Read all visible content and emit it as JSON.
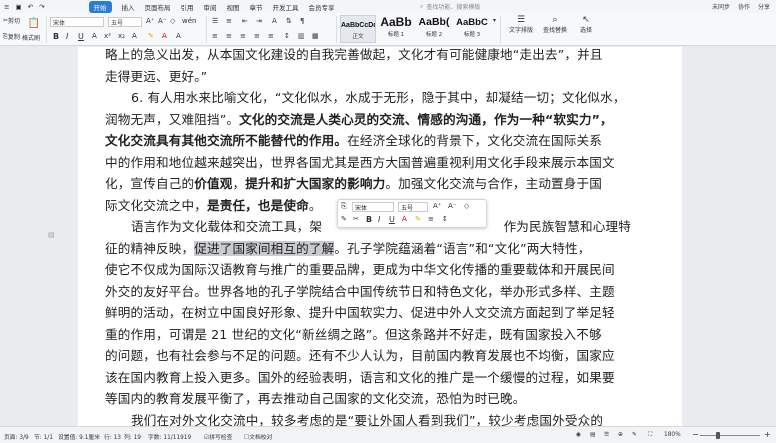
{
  "menu": {
    "left_icons": [
      "menu-icon",
      "save-icon",
      "undo-icon",
      "redo-icon"
    ],
    "tabs": [
      {
        "label": "开始",
        "active": true
      },
      {
        "label": "插入"
      },
      {
        "label": "页面布局"
      },
      {
        "label": "引用"
      },
      {
        "label": "审阅"
      },
      {
        "label": "视图"
      },
      {
        "label": "章节"
      },
      {
        "label": "开发工具"
      },
      {
        "label": "会员专享"
      }
    ],
    "search_placeholder": "查找功能、搜索模板",
    "right_items": [
      "未同步",
      "协作",
      "分享"
    ]
  },
  "ribbon": {
    "cut": "剪切",
    "copy": "复制",
    "paste": "粘贴",
    "format_painter": "格式刷",
    "font_name": "宋体",
    "font_size": "五号",
    "bold": "B",
    "italic": "I",
    "underline": "U",
    "styles": [
      {
        "sample": "AaBbCcDd",
        "label": "正文"
      },
      {
        "sample": "AaBb",
        "label": "标题 1"
      },
      {
        "sample": "AaBb(",
        "label": "标题 2"
      },
      {
        "sample": "AaBbC",
        "label": "标题 3"
      }
    ],
    "text_layout": "文字排版",
    "find_replace": "查找替换",
    "select": "选择"
  },
  "document": {
    "paragraphs": [
      {
        "text": "略上的急义出发，从本国文化建设的自我完善做起，文化才有可能健康地“走出去”，并且"
      },
      {
        "text": "走得更远、更好。”"
      },
      {
        "parts": [
          {
            "t": "6. 有人用水来比喻文化，“文化似水，水成于无形，隐于其中，却凝结一切；文化似水，"
          }
        ]
      },
      {
        "parts": [
          {
            "t": "润物无声，又难阻挡”。"
          },
          {
            "t": "文化的交流是人类心灵的交流、情感的沟通，作为一种“软实力”，",
            "b": true
          }
        ]
      },
      {
        "parts": [
          {
            "t": "文化交流具有其他交流所不能替代的作用。",
            "b": true
          },
          {
            "t": "在经济全球化的背景下，文化交流在国际关系"
          }
        ]
      },
      {
        "text": "中的作用和地位越来越突出，世界各国尤其是西方大国普遍重视利用文化手段来展示本国文"
      },
      {
        "parts": [
          {
            "t": "化，宣传自己的"
          },
          {
            "t": "价值观",
            "b": true
          },
          {
            "t": "，"
          },
          {
            "t": "提升和扩大国家的影响力",
            "b": true
          },
          {
            "t": "。加强文化交流与合作，主动置身于国"
          }
        ]
      },
      {
        "parts": [
          {
            "t": "际文化交流之中，"
          },
          {
            "t": "是责任，也是使命",
            "b": true
          },
          {
            "t": "。"
          }
        ]
      },
      {
        "parts": [
          {
            "t": "语言作为文化载体和交流工具，架"
          },
          {
            "t": "作为民族智慧和心理特",
            "right": true
          }
        ]
      },
      {
        "parts": [
          {
            "t": "征的精神反映，"
          },
          {
            "t": "促进了国家间相互的了解",
            "sel": true
          },
          {
            "t": "。孔子学院蕴涵着“语言”和“文化”两大特性，"
          }
        ]
      },
      {
        "text": "使它不仅成为国际汉语教育与推广的重要品牌，更成为中华文化传播的重要载体和开展民间"
      },
      {
        "text": "外交的友好平台。世界各地的孔子学院结合中国传统节日和特色文化，举办形式多样、主题"
      },
      {
        "text": "鲜明的活动，在树立中国良好形象、提升中国软实力、促进中外人文交流方面起到了举足轻"
      },
      {
        "text": "重的作用，可谓是 21 世纪的文化“新丝绸之路”。但这条路并不好走，既有国家投入不够"
      },
      {
        "text": "的问题，也有社会参与不足的问题。还有不少人认为，目前国内教育发展也不均衡，国家应"
      },
      {
        "text": "该在国内教育上投入更多。国外的经验表明，语言和文化的推广是一个缓慢的过程，如果要"
      },
      {
        "text": "等国内的教育发展平衡了，再去推动自己国家的文化交流，恐怕为时已晚。"
      },
      {
        "text": "我们在对外文化交流中，较多考虑的是“要让外国人看到我们”，较少考虑国外受众的"
      }
    ]
  },
  "mini_toolbar": {
    "font_name": "宋体",
    "font_size": "五号",
    "bold": "B",
    "italic": "I",
    "underline": "U",
    "icons": [
      "copy-icon",
      "format-painter-icon",
      "grow-font-icon",
      "shrink-font-icon",
      "clear-format-icon",
      "font-color-icon",
      "highlight-icon",
      "align-icon",
      "line-spacing-icon"
    ]
  },
  "status": {
    "page": "页面: 3/9",
    "section": "节: 1/1",
    "setting": "设置值: 9.1厘米",
    "row": "行: 13",
    "col": "列: 19",
    "wordcount": "字数: 11/11919",
    "spellcheck": "拼写检查",
    "proofread": "文档校对",
    "zoom": "180%",
    "zoom_minus": "−",
    "zoom_plus": "+",
    "zoom_fraction": 0.3
  },
  "colors": {
    "accent": "#2b7cd3",
    "selection": "#c9cbcf",
    "page": "#ffffff",
    "background": "#e9ebee"
  }
}
